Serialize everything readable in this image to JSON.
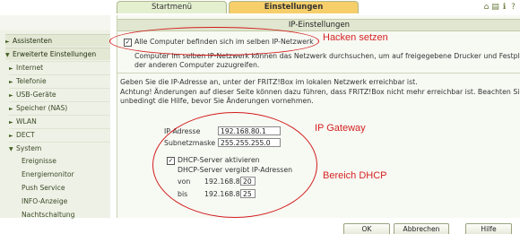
{
  "tabs": {
    "start": "Startmenü",
    "settings": "Einstellungen"
  },
  "top_icons": [
    "home-icon",
    "save-icon",
    "info-icon",
    "help-icon"
  ],
  "sidebar": {
    "items": [
      {
        "label": "Assistenten",
        "arrow": "►"
      },
      {
        "label": "Erweiterte Einstellungen",
        "arrow": "▼"
      },
      {
        "label": "Internet",
        "arrow": "►"
      },
      {
        "label": "Telefonie",
        "arrow": "►"
      },
      {
        "label": "USB-Geräte",
        "arrow": "►"
      },
      {
        "label": "Speicher (NAS)",
        "arrow": "►"
      },
      {
        "label": "WLAN",
        "arrow": "►"
      },
      {
        "label": "DECT",
        "arrow": "►"
      },
      {
        "label": "System",
        "arrow": "▼"
      },
      {
        "label": "Ereignisse"
      },
      {
        "label": "Energiemonitor"
      },
      {
        "label": "Push Service"
      },
      {
        "label": "INFO-Anzeige"
      },
      {
        "label": "Nachtschaltung"
      }
    ]
  },
  "main": {
    "title": "IP-Einstellungen",
    "same_network_checkbox": {
      "label": "Alle Computer befinden sich im selben IP-Netzwerk",
      "checked": true
    },
    "same_network_desc_1": "Computer im selben IP-Netzwerk können das Netzwerk durchsuchen, um auf freigegebene Drucker und Festplatten",
    "same_network_desc_2": "der anderen Computer zuzugreifen.",
    "ip_intro": "Geben Sie die IP-Adresse an, unter der FRITZ!Box im lokalen Netzwerk erreichbar ist.",
    "warning_1": "Achtung! Änderungen auf dieser Seite können dazu führen, dass FRITZ!Box nicht mehr erreichbar ist. Beachten Sie",
    "warning_2": "unbedingt die Hilfe, bevor Sie Änderungen vornehmen.",
    "ip_label": "IP-Adresse",
    "ip_value": "192.168.80.1",
    "subnet_label": "Subnetzmaske",
    "subnet_value": "255.255.255.0",
    "dhcp_checkbox": {
      "label": "DHCP-Server aktivieren",
      "checked": true
    },
    "dhcp_range_text": "DHCP-Server vergibt IP-Adressen",
    "from_label": "von",
    "from_prefix": "192.168.80.",
    "from_value": "20",
    "to_label": "bis",
    "to_prefix": "192.168.80.",
    "to_value": "25",
    "buttons": {
      "ok": "OK",
      "cancel": "Abbrechen",
      "help": "Hilfe"
    }
  },
  "annotations": {
    "note_1": "Hacken setzen",
    "note_2": "IP Gateway",
    "note_3": "Bereich DHCP",
    "color": "#d21b1b"
  }
}
